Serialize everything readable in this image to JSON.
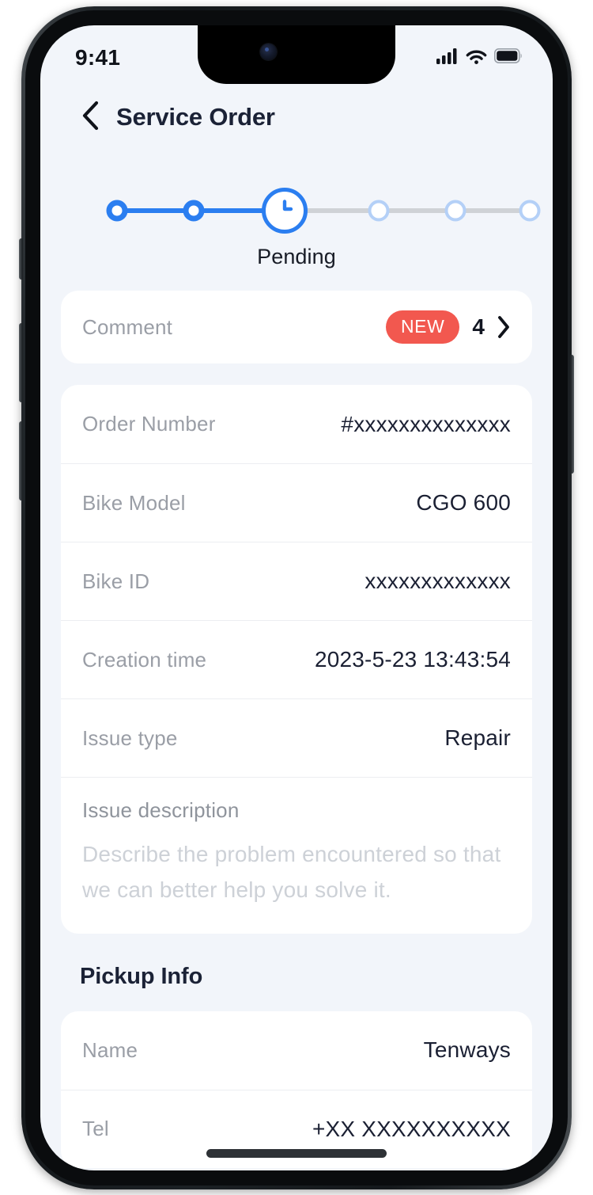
{
  "status_bar": {
    "time": "9:41",
    "signal_icon": "cellular-signal-icon",
    "wifi_icon": "wifi-icon",
    "battery_icon": "battery-full-icon"
  },
  "header": {
    "back_icon": "chevron-left-icon",
    "title": "Service Order"
  },
  "stepper": {
    "current_label": "Pending",
    "active_icon": "clock-icon",
    "total_steps": 6,
    "active_index": 3,
    "steps": [
      {
        "state": "done"
      },
      {
        "state": "done"
      },
      {
        "state": "active",
        "label": "Pending"
      },
      {
        "state": "todo"
      },
      {
        "state": "todo"
      },
      {
        "state": "todo"
      }
    ],
    "color_done": "#2b7ef0",
    "color_todo": "#cfd2d6",
    "color_todo_ring": "#b4d0f7"
  },
  "comment": {
    "label": "Comment",
    "badge": "NEW",
    "badge_color": "#f2584f",
    "count": "4",
    "chevron_icon": "chevron-right-icon"
  },
  "order_details": [
    {
      "label": "Order Number",
      "value": "#xxxxxxxxxxxxxx"
    },
    {
      "label": "Bike Model",
      "value": "CGO 600"
    },
    {
      "label": "Bike ID",
      "value": "xxxxxxxxxxxxx"
    },
    {
      "label": "Creation time",
      "value": "2023-5-23 13:43:54"
    },
    {
      "label": "Issue type",
      "value": "Repair"
    }
  ],
  "issue_description": {
    "label": "Issue description",
    "placeholder": "Describe the problem encountered so that we can better help you solve it."
  },
  "pickup_info": {
    "section_title": "Pickup Info",
    "rows": [
      {
        "label": "Name",
        "value": "Tenways"
      },
      {
        "label": "Tel",
        "value": "+XX XXXXXXXXXX"
      }
    ]
  },
  "home_indicator": "home-indicator"
}
